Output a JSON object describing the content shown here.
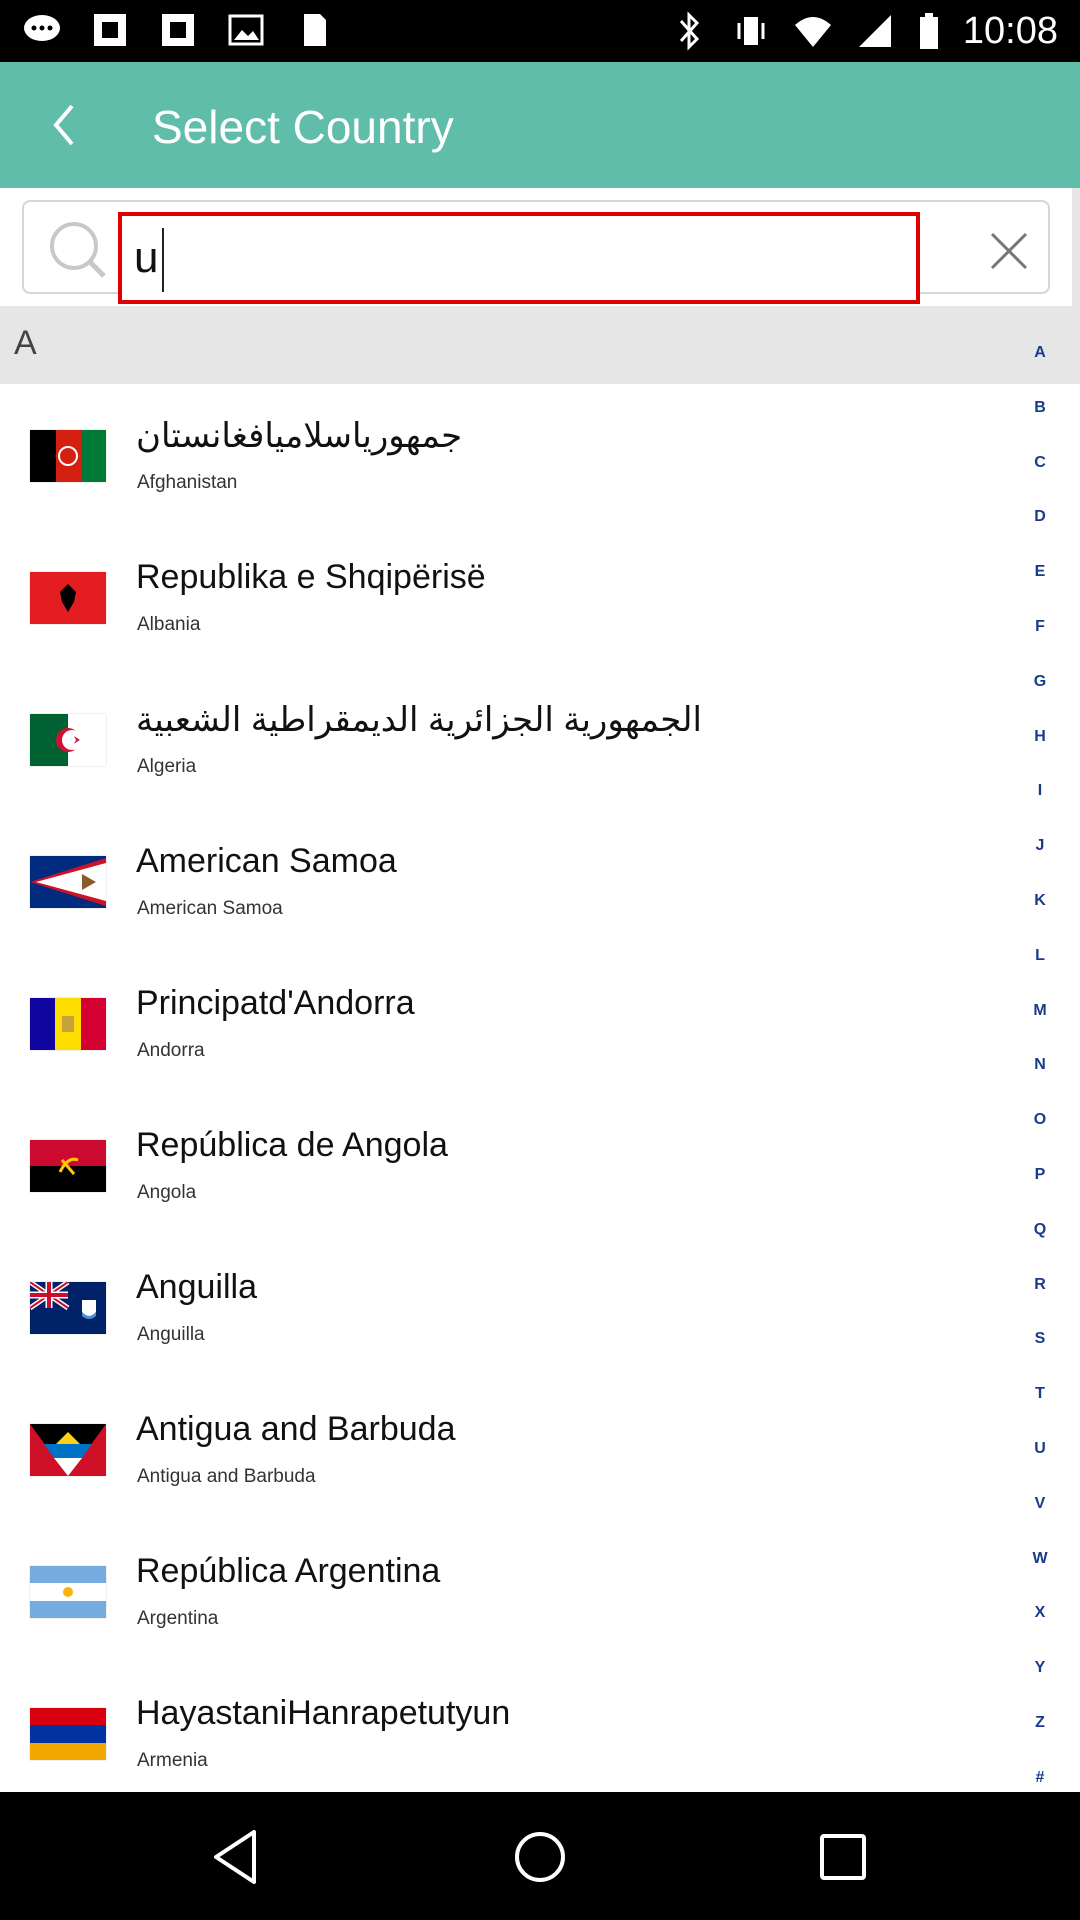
{
  "status_bar": {
    "time": "10:08",
    "icons_left": [
      "chat-bubble-icon",
      "notification-square-icon",
      "notification-square-icon",
      "image-icon",
      "sim-card-icon"
    ],
    "icons_right": [
      "bluetooth-icon",
      "vibrate-icon",
      "wifi-icon",
      "signal-icon",
      "battery-icon"
    ]
  },
  "app_bar": {
    "title": "Select Country",
    "background_color": "#5fbdaa"
  },
  "search": {
    "value": "u",
    "highlight_color": "#e00000"
  },
  "section": {
    "letter": "A"
  },
  "countries": [
    {
      "native": "جمهوریاسلامیافغانستان",
      "english": "Afghanistan",
      "flag": "afghanistan"
    },
    {
      "native": "Republika e Shqipërisë",
      "english": "Albania",
      "flag": "albania"
    },
    {
      "native": "الجمهورية الجزائرية الديمقراطية الشعبية",
      "english": "Algeria",
      "flag": "algeria"
    },
    {
      "native": "American Samoa",
      "english": "American Samoa",
      "flag": "american-samoa"
    },
    {
      "native": "Principatd'Andorra",
      "english": "Andorra",
      "flag": "andorra"
    },
    {
      "native": "República de Angola",
      "english": "Angola",
      "flag": "angola"
    },
    {
      "native": "Anguilla",
      "english": "Anguilla",
      "flag": "anguilla"
    },
    {
      "native": "Antigua and Barbuda",
      "english": "Antigua and Barbuda",
      "flag": "antigua"
    },
    {
      "native": "República Argentina",
      "english": "Argentina",
      "flag": "argentina"
    },
    {
      "native": "HayastaniHanrapetutyun",
      "english": "Armenia",
      "flag": "armenia"
    }
  ],
  "alphabet_index": [
    "A",
    "B",
    "C",
    "D",
    "E",
    "F",
    "G",
    "H",
    "I",
    "J",
    "K",
    "L",
    "M",
    "N",
    "O",
    "P",
    "Q",
    "R",
    "S",
    "T",
    "U",
    "V",
    "W",
    "X",
    "Y",
    "Z",
    "#"
  ],
  "nav_bar": {
    "buttons": [
      "back-triangle-icon",
      "home-circle-icon",
      "recents-square-icon"
    ]
  }
}
